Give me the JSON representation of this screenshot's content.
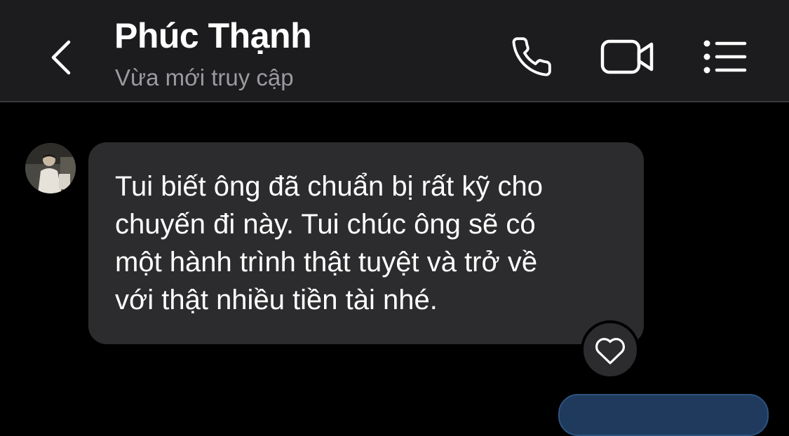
{
  "header": {
    "contact_name": "Phúc Thạnh",
    "status": "Vừa mới truy cập",
    "back_icon": "chevron-left-icon",
    "call_icon": "phone-icon",
    "video_icon": "video-camera-icon",
    "menu_icon": "list-menu-icon"
  },
  "messages": [
    {
      "sender": "Phúc Thạnh",
      "direction": "incoming",
      "text": "Tui biết ông đã chuẩn bị rất kỹ cho\nchuyến đi này. Tui chúc ông sẽ có\nmột hành trình thật tuyệt và trở về\nvới thật nhiều tiền tài nhé.",
      "reaction_icon": "heart-outline-icon"
    }
  ],
  "colors": {
    "background": "#000000",
    "header": "#1c1c1e",
    "bubble_incoming": "#2c2c2e",
    "text_primary": "#ffffff",
    "text_secondary": "#9a9aa0",
    "bubble_outgoing": "#1f3a5c"
  }
}
